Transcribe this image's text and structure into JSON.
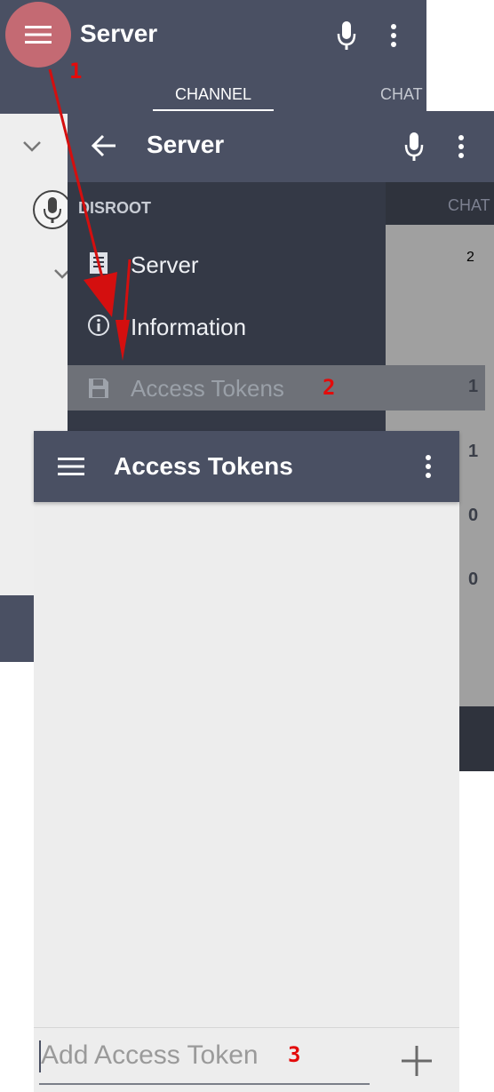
{
  "screen1": {
    "title": "Server",
    "tabs": [
      "CHANNEL",
      "CHAT"
    ]
  },
  "screen2": {
    "title": "Server",
    "section_header": "DISROOT",
    "menu": [
      "Server",
      "Information",
      "Access Tokens"
    ],
    "tab_partial": "CHAT",
    "counts": [
      "2",
      "1",
      "1",
      "0",
      "0"
    ]
  },
  "screen3": {
    "title": "Access Tokens",
    "input_placeholder": "Add Access Token"
  },
  "annotations": [
    "1",
    "2",
    "3"
  ],
  "colors": {
    "app_bar": "#4a5063",
    "drawer": "#343946",
    "annotation": "#e30b0b"
  }
}
